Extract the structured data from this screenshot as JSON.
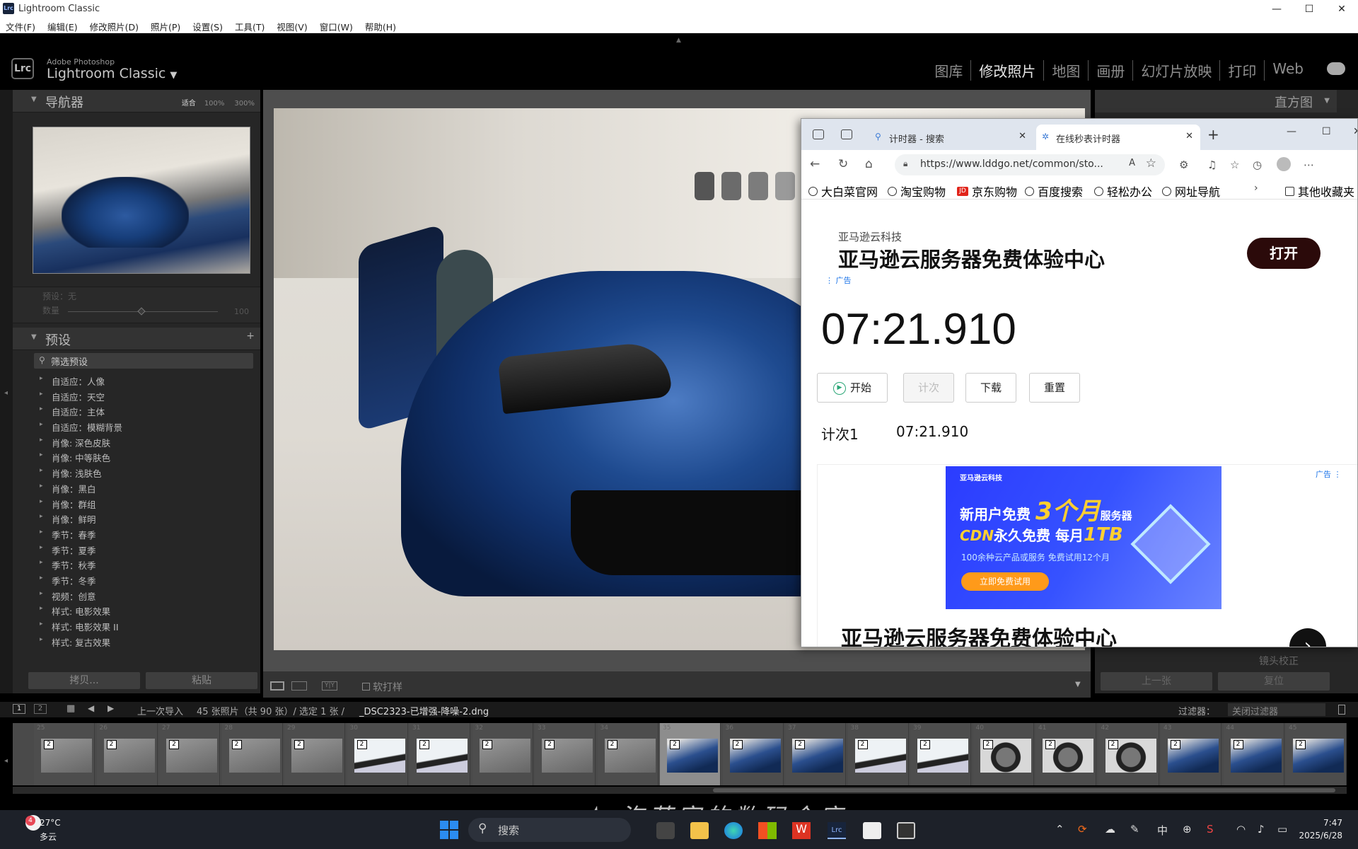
{
  "app": {
    "title": "Lightroom Classic",
    "brand_small": "Adobe Photoshop",
    "brand_large": "Lightroom Classic",
    "logo": "Lrc"
  },
  "window_controls": {
    "minimize": "—",
    "maximize": "☐",
    "close": "✕"
  },
  "menu": [
    "文件(F)",
    "编辑(E)",
    "修改照片(D)",
    "照片(P)",
    "设置(S)",
    "工具(T)",
    "视图(V)",
    "窗口(W)",
    "帮助(H)"
  ],
  "modules": [
    {
      "label": "图库",
      "active": false
    },
    {
      "label": "修改照片",
      "active": true
    },
    {
      "label": "地图",
      "active": false
    },
    {
      "label": "画册",
      "active": false
    },
    {
      "label": "幻灯片放映",
      "active": false
    },
    {
      "label": "打印",
      "active": false
    },
    {
      "label": "Web",
      "active": false
    }
  ],
  "navigator": {
    "title": "导航器",
    "zoom_fit": "适合",
    "zoom_100": "100%",
    "zoom_300": "300%"
  },
  "preset_amount": {
    "preset_label": "预设：无",
    "amount_label": "数量",
    "amount_value": "100",
    "slider_fraction": 0.5
  },
  "presets": {
    "title": "预设",
    "add": "+",
    "filter_placeholder": "筛选预设",
    "items": [
      "自适应：人像",
      "自适应：天空",
      "自适应：主体",
      "自适应：模糊背景",
      "肖像: 深色皮肤",
      "肖像: 中等肤色",
      "肖像: 浅肤色",
      "肖像：黑白",
      "肖像：群组",
      "肖像：鲜明",
      "季节：春季",
      "季节：夏季",
      "季节：秋季",
      "季节：冬季",
      "视频：创意",
      "样式: 电影效果",
      "样式: 电影效果 II",
      "样式: 复古效果"
    ]
  },
  "left_buttons": {
    "copy": "拷贝...",
    "paste": "粘贴"
  },
  "toolbar": {
    "soft_proof": "软打样",
    "compare_label": "Y|Y"
  },
  "right_panel": {
    "histogram": "直方图",
    "lens_correction": "镜头校正",
    "prev": "上一张",
    "reset": "复位"
  },
  "browser": {
    "tabs": [
      {
        "title": "计时器 - 搜索",
        "icon": "search-icon",
        "active": false
      },
      {
        "title": "在线秒表计时器",
        "icon": "gear-icon",
        "active": true
      }
    ],
    "url": "https://www.lddgo.net/common/sto...",
    "bookmarks": [
      "大白菜官网",
      "淘宝购物",
      "京东购物",
      "百度搜索",
      "轻松办公",
      "网址导航"
    ],
    "other_favorites": "其他收藏夹",
    "ad_top": {
      "company": "亚马逊云科技",
      "headline": "亚马逊云服务器免费体验中心",
      "tag": "广告",
      "button": "打开"
    },
    "stopwatch": {
      "time": "07:21.910",
      "start": "开始",
      "lap": "计次",
      "download": "下载",
      "reset": "重置"
    },
    "lap_row": {
      "label": "计次1",
      "time": "07:21.910"
    },
    "banner": {
      "brand": "亚马逊云科技",
      "line1_pre": "新用户免费",
      "line1_big": "3个月",
      "line1_post": "服务器",
      "line2_pre": "CDN",
      "line2_mid": "永久免费 每月",
      "line2_big": "1TB",
      "line3": "100余种云产品或服务 免费试用12个月",
      "cta": "立即免费试用",
      "tag": "广告"
    },
    "ad_bottom_headline": "亚马逊云服务器免费体验中心"
  },
  "filmstrip": {
    "view1": "1",
    "view2": "2",
    "source": "上一次导入",
    "count": "45 张照片（共 90 张）/ 选定 1 张 /",
    "filename": "_DSC2323-已增强-降噪-2.dng",
    "filter_label": "过滤器：",
    "filter_value": "关闭过滤器",
    "cells": [
      {
        "num": "25",
        "kind": "grey",
        "selected": false
      },
      {
        "num": "26",
        "kind": "grey",
        "selected": false
      },
      {
        "num": "27",
        "kind": "grey",
        "selected": false
      },
      {
        "num": "28",
        "kind": "grey",
        "selected": false
      },
      {
        "num": "29",
        "kind": "grey",
        "selected": false
      },
      {
        "num": "30",
        "kind": "win",
        "selected": false
      },
      {
        "num": "31",
        "kind": "win",
        "selected": false
      },
      {
        "num": "32",
        "kind": "grey",
        "selected": false
      },
      {
        "num": "33",
        "kind": "grey",
        "selected": false
      },
      {
        "num": "34",
        "kind": "grey",
        "selected": false
      },
      {
        "num": "35",
        "kind": "blue",
        "selected": true
      },
      {
        "num": "36",
        "kind": "blue",
        "selected": false
      },
      {
        "num": "37",
        "kind": "blue",
        "selected": false
      },
      {
        "num": "38",
        "kind": "win",
        "selected": false
      },
      {
        "num": "39",
        "kind": "win",
        "selected": false
      },
      {
        "num": "40",
        "kind": "wheel",
        "selected": false
      },
      {
        "num": "41",
        "kind": "wheel",
        "selected": false
      },
      {
        "num": "42",
        "kind": "wheel",
        "selected": false
      },
      {
        "num": "43",
        "kind": "blue",
        "selected": false
      },
      {
        "num": "44",
        "kind": "blue",
        "selected": false
      },
      {
        "num": "45",
        "kind": "blue",
        "selected": false
      }
    ],
    "badge": "2"
  },
  "taskbar": {
    "weather_badge": "4",
    "temp": "27°C",
    "condition": "多云",
    "search": "搜索",
    "ime": "中",
    "time": "7:47",
    "date": "2025/6/28"
  },
  "watermark": "泡芙家的数码仓库",
  "colors": {
    "accent_win": "#2b8cf0",
    "stopwatch_green": "#2aa676",
    "ad_blue": "#3652ff",
    "ad_yellow": "#ffcf30",
    "open_btn": "#2b0a0a"
  }
}
